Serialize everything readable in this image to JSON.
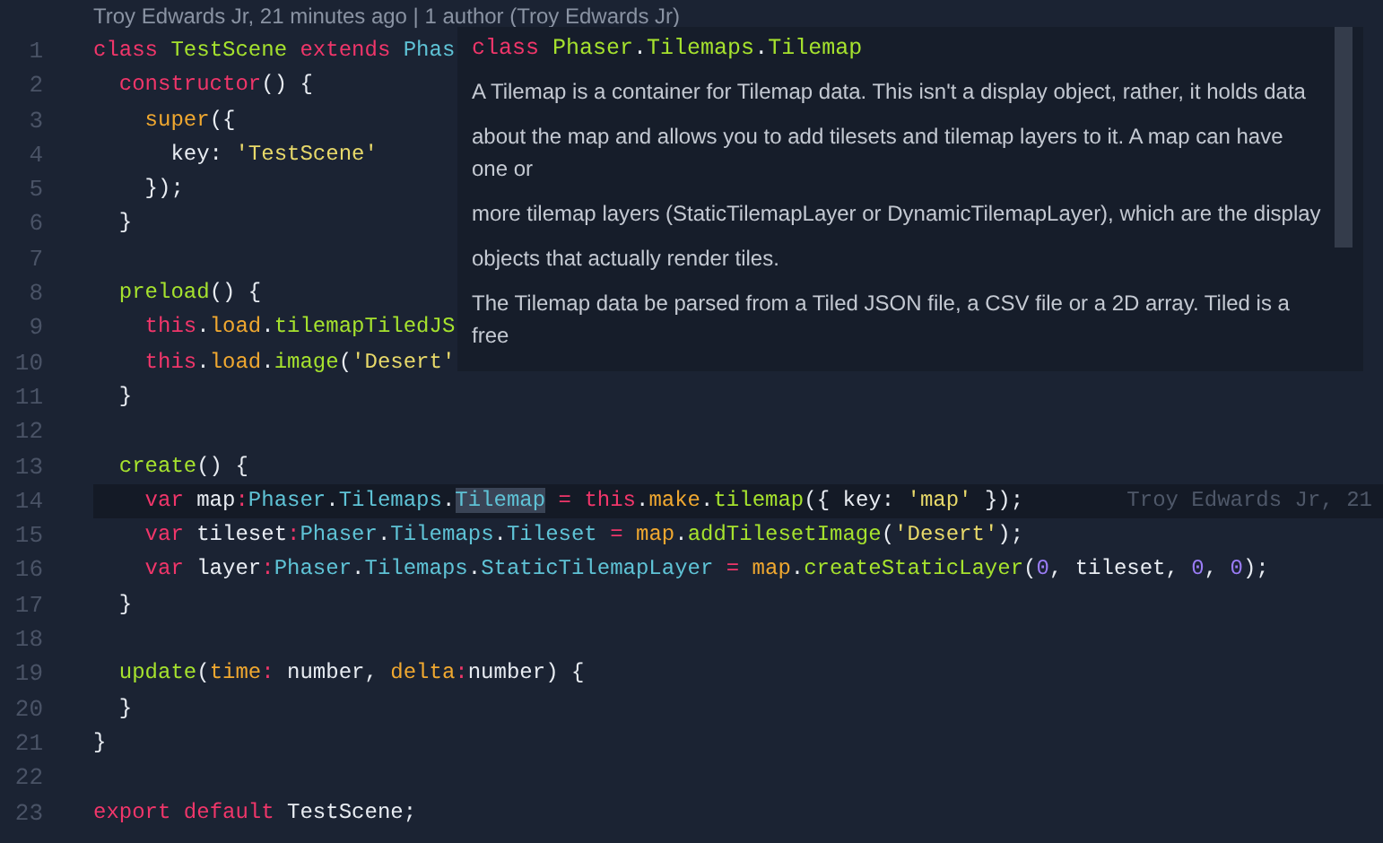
{
  "blame_header": "Troy Edwards Jr, 21 minutes ago | 1 author (Troy Edwards Jr)",
  "lines": [
    {
      "number": "1",
      "tokens": [
        {
          "kind": "kw",
          "t": "class "
        },
        {
          "kind": "cls",
          "t": "TestScene "
        },
        {
          "kind": "kw",
          "t": "extends "
        },
        {
          "kind": "type",
          "t": "Phas"
        }
      ]
    },
    {
      "number": "2",
      "tokens": [
        {
          "kind": "kw",
          "t": "  constructor"
        },
        {
          "kind": "plain",
          "t": "() {"
        }
      ]
    },
    {
      "number": "3",
      "tokens": [
        {
          "kind": "param",
          "t": "    super"
        },
        {
          "kind": "plain",
          "t": "({"
        }
      ]
    },
    {
      "number": "4",
      "tokens": [
        {
          "kind": "plain",
          "t": "      key: "
        },
        {
          "kind": "str",
          "t": "'TestScene'"
        }
      ]
    },
    {
      "number": "5",
      "tokens": [
        {
          "kind": "plain",
          "t": "    });"
        }
      ]
    },
    {
      "number": "6",
      "tokens": [
        {
          "kind": "plain",
          "t": "  }"
        }
      ]
    },
    {
      "number": "7"
    },
    {
      "number": "8",
      "tokens": [
        {
          "kind": "fn",
          "t": "  preload"
        },
        {
          "kind": "plain",
          "t": "() {"
        }
      ]
    },
    {
      "number": "9",
      "tokens": [
        {
          "kind": "kw",
          "t": "    this"
        },
        {
          "kind": "plain",
          "t": "."
        },
        {
          "kind": "param",
          "t": "load"
        },
        {
          "kind": "plain",
          "t": "."
        },
        {
          "kind": "fn",
          "t": "tilemapTiledJS"
        }
      ]
    },
    {
      "number": "10",
      "tokens": [
        {
          "kind": "kw",
          "t": "    this"
        },
        {
          "kind": "plain",
          "t": "."
        },
        {
          "kind": "param",
          "t": "load"
        },
        {
          "kind": "plain",
          "t": "."
        },
        {
          "kind": "fn",
          "t": "image"
        },
        {
          "kind": "plain",
          "t": "("
        },
        {
          "kind": "str",
          "t": "'Desert'"
        }
      ]
    },
    {
      "number": "11",
      "tokens": [
        {
          "kind": "plain",
          "t": "  }"
        }
      ]
    },
    {
      "number": "12"
    },
    {
      "number": "13",
      "tokens": [
        {
          "kind": "fn",
          "t": "  create"
        },
        {
          "kind": "plain",
          "t": "() {"
        }
      ]
    },
    {
      "number": "14",
      "current": true,
      "blame": "Troy Edwards Jr, 21",
      "tokens": [
        {
          "kind": "kw",
          "t": "    var "
        },
        {
          "kind": "plain",
          "t": "map"
        },
        {
          "kind": "kw",
          "t": ":"
        },
        {
          "kind": "type",
          "t": "Phaser"
        },
        {
          "kind": "plain",
          "t": "."
        },
        {
          "kind": "type",
          "t": "Tilemaps"
        },
        {
          "kind": "plain",
          "t": "."
        },
        {
          "kind": "type",
          "t": "Tilemap",
          "selected": true
        },
        {
          "kind": "kw",
          "t": " = "
        },
        {
          "kind": "kw",
          "t": "this"
        },
        {
          "kind": "plain",
          "t": "."
        },
        {
          "kind": "param",
          "t": "make"
        },
        {
          "kind": "plain",
          "t": "."
        },
        {
          "kind": "fn",
          "t": "tilemap"
        },
        {
          "kind": "plain",
          "t": "({ key: "
        },
        {
          "kind": "str",
          "t": "'map'"
        },
        {
          "kind": "plain",
          "t": " });"
        }
      ]
    },
    {
      "number": "15",
      "current": false,
      "tokens": [
        {
          "kind": "kw",
          "t": "    var "
        },
        {
          "kind": "plain",
          "t": "tileset"
        },
        {
          "kind": "kw",
          "t": ":"
        },
        {
          "kind": "type",
          "t": "Phaser"
        },
        {
          "kind": "plain",
          "t": "."
        },
        {
          "kind": "type",
          "t": "Tilemaps"
        },
        {
          "kind": "plain",
          "t": "."
        },
        {
          "kind": "type",
          "t": "Tileset"
        },
        {
          "kind": "kw",
          "t": " = "
        },
        {
          "kind": "param",
          "t": "map"
        },
        {
          "kind": "plain",
          "t": "."
        },
        {
          "kind": "fn",
          "t": "addTilesetImage"
        },
        {
          "kind": "plain",
          "t": "("
        },
        {
          "kind": "str",
          "t": "'Desert'"
        },
        {
          "kind": "plain",
          "t": ");"
        }
      ]
    },
    {
      "number": "16",
      "tokens": [
        {
          "kind": "kw",
          "t": "    var "
        },
        {
          "kind": "plain",
          "t": "layer"
        },
        {
          "kind": "kw",
          "t": ":"
        },
        {
          "kind": "type",
          "t": "Phaser"
        },
        {
          "kind": "plain",
          "t": "."
        },
        {
          "kind": "type",
          "t": "Tilemaps"
        },
        {
          "kind": "plain",
          "t": "."
        },
        {
          "kind": "type",
          "t": "StaticTilemapLayer"
        },
        {
          "kind": "kw",
          "t": " = "
        },
        {
          "kind": "param",
          "t": "map"
        },
        {
          "kind": "plain",
          "t": "."
        },
        {
          "kind": "fn",
          "t": "createStaticLayer"
        },
        {
          "kind": "plain",
          "t": "("
        },
        {
          "kind": "num",
          "t": "0"
        },
        {
          "kind": "plain",
          "t": ", tileset, "
        },
        {
          "kind": "num",
          "t": "0"
        },
        {
          "kind": "plain",
          "t": ", "
        },
        {
          "kind": "num",
          "t": "0"
        },
        {
          "kind": "plain",
          "t": ");"
        }
      ]
    },
    {
      "number": "17",
      "tokens": [
        {
          "kind": "plain",
          "t": "  }"
        }
      ]
    },
    {
      "number": "18"
    },
    {
      "number": "19",
      "tokens": [
        {
          "kind": "fn",
          "t": "  update"
        },
        {
          "kind": "plain",
          "t": "("
        },
        {
          "kind": "param",
          "t": "time"
        },
        {
          "kind": "kw",
          "t": ":"
        },
        {
          "kind": "plain",
          "t": " number, "
        },
        {
          "kind": "param",
          "t": "delta"
        },
        {
          "kind": "kw",
          "t": ":"
        },
        {
          "kind": "plain",
          "t": "number) {"
        }
      ]
    },
    {
      "number": "20",
      "tokens": [
        {
          "kind": "plain",
          "t": "  }"
        }
      ]
    },
    {
      "number": "21",
      "tokens": [
        {
          "kind": "plain",
          "t": "}"
        }
      ]
    },
    {
      "number": "22"
    },
    {
      "number": "23",
      "tokens": [
        {
          "kind": "kw",
          "t": "export "
        },
        {
          "kind": "kw",
          "t": "default "
        },
        {
          "kind": "plain",
          "t": "TestScene;"
        }
      ]
    }
  ],
  "hover": {
    "signature": [
      {
        "kind": "kw",
        "t": "class "
      },
      {
        "kind": "cls",
        "t": "Phaser"
      },
      {
        "kind": "plain",
        "t": "."
      },
      {
        "kind": "cls",
        "t": "Tilemaps"
      },
      {
        "kind": "plain",
        "t": "."
      },
      {
        "kind": "cls",
        "t": "Tilemap"
      }
    ],
    "paragraphs": [
      "A Tilemap is a container for Tilemap data. This isn't a display object, rather, it holds data",
      "about the map and allows you to add tilesets and tilemap layers to it. A map can have one or",
      "more tilemap layers (StaticTilemapLayer or DynamicTilemapLayer), which are the display",
      "objects that actually render tiles.",
      "The Tilemap data be parsed from a Tiled JSON file, a CSV file or a 2D array. Tiled is a free"
    ]
  }
}
